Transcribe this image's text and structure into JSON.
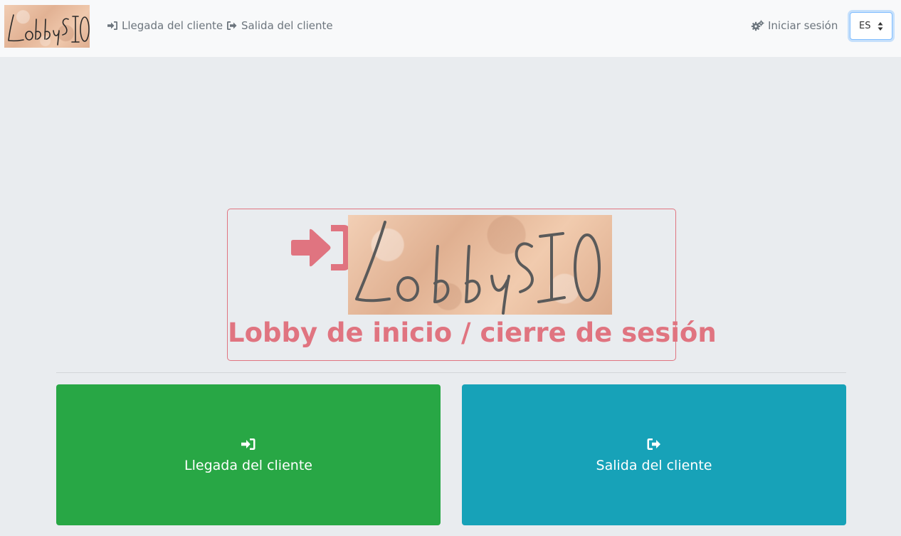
{
  "brand": {
    "logo_text": "LobbySIO"
  },
  "nav": {
    "arrival_label": "Llegada del cliente",
    "departure_label": "Salida del cliente",
    "login_label": "Iniciar sesión",
    "language": {
      "selected": "ES"
    }
  },
  "hero": {
    "logo_text": "LobbySIO",
    "title": "Lobby de inicio / cierre de sesión"
  },
  "actions": {
    "arrival_label": "Llegada del cliente",
    "departure_label": "Salida del cliente"
  },
  "colors": {
    "accent": "#e07480",
    "arrival": "#28a745",
    "departure": "#17a2b8"
  }
}
